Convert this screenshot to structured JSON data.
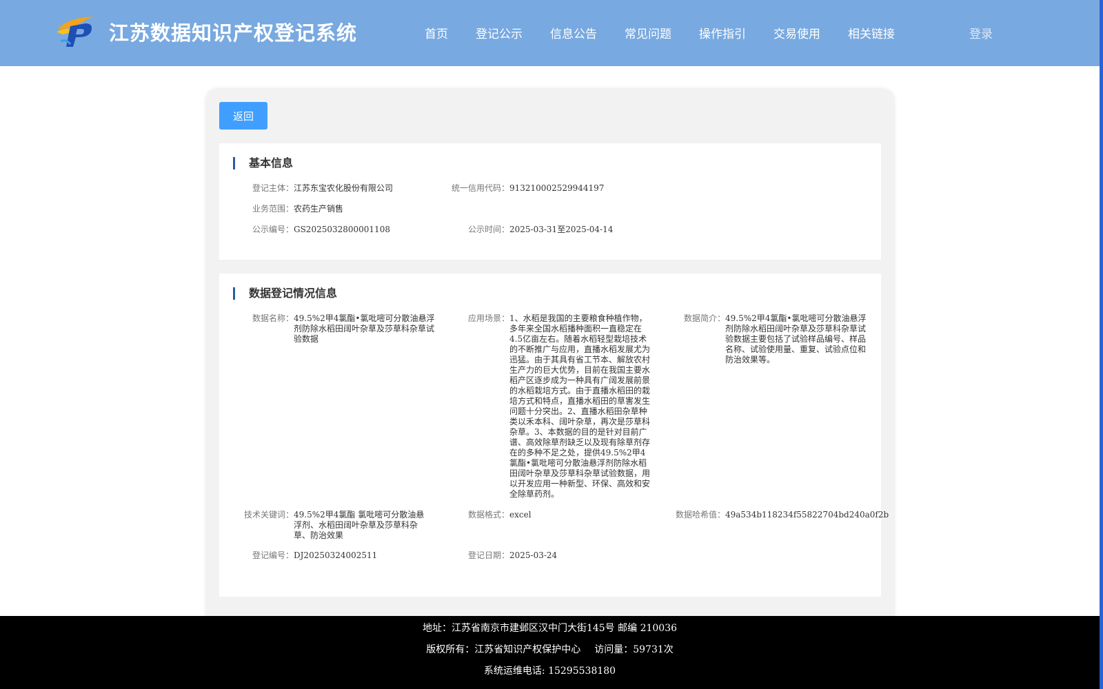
{
  "header": {
    "site_title": "江苏数据知识产权登记系统",
    "nav": [
      "首页",
      "登记公示",
      "信息公告",
      "常见问题",
      "操作指引",
      "交易使用",
      "相关链接"
    ],
    "login_label": "登录"
  },
  "back_label": "返回",
  "basic": {
    "title": "基本信息",
    "subject_label": "登记主体：",
    "subject": "江苏东宝农化股份有限公司",
    "credit_label": "统一信用代码：",
    "credit": "913210002529944197",
    "scope_label": "业务范围：",
    "scope": "农药生产销售",
    "pubno_label": "公示编号：",
    "pubno": "GS2025032800001108",
    "pubtime_label": "公示时间：",
    "pubtime": "2025-03-31至2025-04-14"
  },
  "data": {
    "title": "数据登记情况信息",
    "name_label": "数据名称：",
    "name": "49.5%2甲4氯酯•氯吡嘧可分散油悬浮剂防除水稻田阔叶杂草及莎草科杂草试验数据",
    "scene_label": "应用场景：",
    "scene": "1、水稻是我国的主要粮食种植作物，多年来全国水稻播种面积一直稳定在4.5亿亩左右。随着水稻轻型栽培技术的不断推广与应用，直播水稻发展尤为迅猛。由于其具有省工节本、解放农村生产力的巨大优势，目前在我国主要水稻产区逐步成为一种具有广阔发展前景的水稻栽培方式。由于直播水稻田的栽培方式和特点，直播水稻田的草害发生问题十分突出。2、直播水稻田杂草种类以禾本科、阔叶杂草，再次是莎草科杂草。3、本数据的目的是针对目前广谱、高效除草剂缺乏以及现有除草剂存在的多种不足之处，提供49.5%2甲4氯酯•氯吡嘧可分散油悬浮剂防除水稻田阔叶杂草及莎草科杂草试验数据，用以开发应用一种新型、环保、高效和安全除草药剂。",
    "intro_label": "数据简介：",
    "intro": "49.5%2甲4氯酯•氯吡嘧可分散油悬浮剂防除水稻田阔叶杂草及莎草科杂草试验数据主要包括了试验样品编号、样品名称、试验使用量、重复、试验点位和防治效果等。",
    "keywords_label": "技术关键词：",
    "keywords": "49.5%2甲4氯酯 氯吡嘧可分散油悬浮剂、水稻田阔叶杂草及莎草科杂草、防治效果",
    "format_label": "数据格式：",
    "format": "excel",
    "hash_label": "数据哈希值：",
    "hash": "49a534b118234f55822704bd240a0f2b",
    "regno_label": "登记编号：",
    "regno": "DJ20250324002511",
    "regdate_label": "登记日期：",
    "regdate": "2025-03-24"
  },
  "footer": {
    "address": "地址：江苏省南京市建邺区汉中门大街145号 邮编 210036",
    "copyright": "版权所有：江苏省知识产权保护中心",
    "visits": "访问量：59731次",
    "phone": "系统运维电话: 15295538180"
  },
  "colors": {
    "header_bg": "#78a9e0",
    "button_bg": "#409eff",
    "accent_bar": "#2c5aa0",
    "footer_bg": "#000000"
  }
}
